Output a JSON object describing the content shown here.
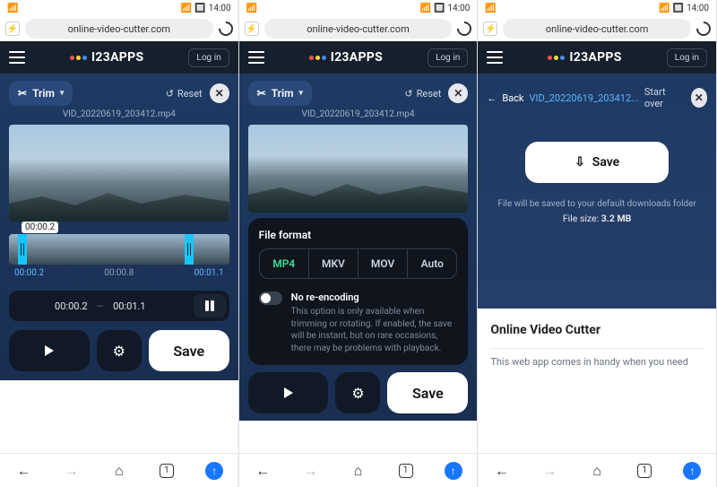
{
  "status": {
    "time": "14:00"
  },
  "browser": {
    "url": "online-video-cutter.com",
    "tab_count": "1"
  },
  "header": {
    "brand": "I23APPS",
    "login": "Log in"
  },
  "toolbar": {
    "trim": "Trim",
    "reset": "Reset"
  },
  "file": {
    "name": "VID_20220619_203412.mp4"
  },
  "timeline": {
    "tooltip": "00:00.2",
    "labels": [
      "00:00.2",
      "00:00.8",
      "00:01.1"
    ],
    "range_start": "00:00.2",
    "range_end": "00:01.1"
  },
  "actions": {
    "save": "Save"
  },
  "formatSheet": {
    "title": "File format",
    "options": [
      "MP4",
      "MKV",
      "MOV",
      "Auto"
    ],
    "toggle_title": "No re-encoding",
    "toggle_desc": "This option is only available when trimming or rotating. If enabled, the save will be instant, but on rare occasions, there may be problems with playback."
  },
  "savePage": {
    "back": "Back",
    "filename_short": "VID_20220619_203412...",
    "start_over": "Start over",
    "save": "Save",
    "msg": "File will be saved to your default downloads folder",
    "size_label": "File size:",
    "size_value": "3.2 MB"
  },
  "article": {
    "title": "Online Video Cutter",
    "body": "This web app comes in handy when you need"
  }
}
